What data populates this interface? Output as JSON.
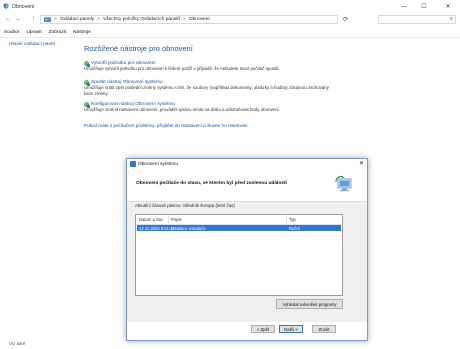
{
  "window": {
    "title": "Obnovení",
    "minimize": "—",
    "maximize": "☐",
    "close": "✕"
  },
  "nav": {
    "back": "←",
    "forward": "→",
    "up": "↑",
    "breadcrumb": [
      "Ovládací panely",
      "Všechny položky Ovládacích panelů",
      "Obnovení"
    ],
    "breadcrumb_sep": ">",
    "refresh": "⟳",
    "search_placeholder": "",
    "search_icon": "⌕"
  },
  "menu": [
    "Soubor",
    "Upravit",
    "Zobrazit",
    "Nástroje"
  ],
  "sidebar": {
    "home_link": "Hlavní ovládací panel",
    "see_also": "Viz také"
  },
  "main": {
    "title": "Rozšířené nástroje pro obnovení",
    "tools": [
      {
        "link": "Vytvořit jednotku pro obnovení",
        "desc": "Umožňuje vytvořit jednotku pro obnovení k řešení potíží v případě, že nebudete moct  počítač spustit."
      },
      {
        "link": "Spustit nástroj Obnovení systému",
        "desc": "Umožňuje vrátit zpět poslední změny systému s tím, že soubory (například dokumenty, obrázky a hudba) zůstanou zachovány beze změny."
      },
      {
        "link": "Konfigurovat nástroj Obnovení systému",
        "desc": "Umožňuje změnit nastavení obnovení, provádět správu místa na disku a odstraňovat body obnovení."
      }
    ],
    "bottom_link": "Pokud máte s počítačem problémy, přejděte do Nastavení a zkuste ho resetovat."
  },
  "dialog": {
    "title": "Obnovení systému",
    "close": "✕",
    "heading": "Obnovení počítače do stavu, ve kterém byl před zvolenou událostí",
    "timezone": "Aktuální časové pásmo: Středník Evropa (letní čas)",
    "columns": [
      "Datum a čas",
      "Popis",
      "Typ"
    ],
    "rows": [
      {
        "date": "12.11.2020 9:01:41",
        "desc": "Instalace ovladače",
        "type": "Ruční"
      }
    ],
    "scan_button": "Vyhledat ovlivněné programy",
    "back_button": "< Zpět",
    "next_button": "Další >",
    "cancel_button": "Zrušit"
  }
}
